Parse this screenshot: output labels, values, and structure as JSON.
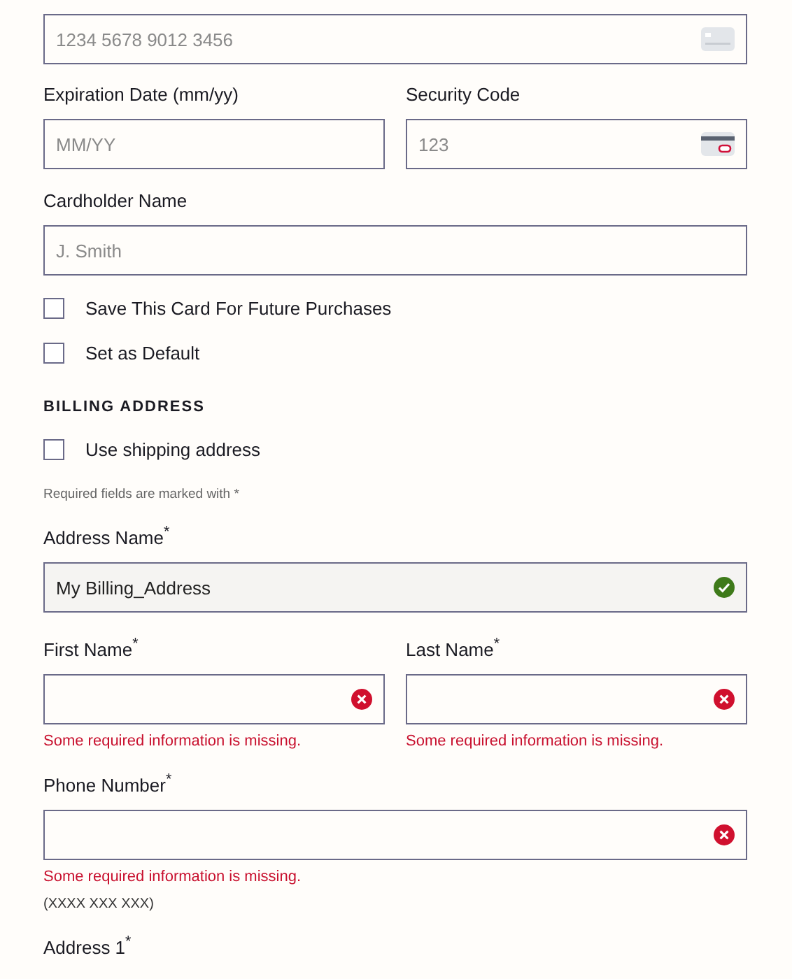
{
  "card_number": {
    "placeholder": "1234 5678 9012 3456"
  },
  "card_row": [
    {
      "label": "Expiration Date (mm/yy)",
      "placeholder": "MM/YY",
      "kind": "plain"
    },
    {
      "label": "Security Code",
      "placeholder": "123",
      "kind": "cvc"
    }
  ],
  "cardholder": {
    "label": "Cardholder Name",
    "placeholder": "J. Smith"
  },
  "card_options": [
    {
      "label": "Save This Card For Future Purchases",
      "checked": false
    },
    {
      "label": "Set as Default",
      "checked": false
    }
  ],
  "billing": {
    "heading": "BILLING ADDRESS",
    "use_shipping": {
      "label": "Use shipping address",
      "checked": false
    },
    "required_note": "Required fields are marked with *",
    "rows": [
      [
        {
          "label": "Address Name$^{*}$",
          "value": "My Billing_Address",
          "valid": true
        }
      ],
      [
        {
          "label": "First Name$^{*}$",
          "valid": false,
          "error": "Some required information is missing."
        },
        {
          "label": "Last Name$^{*}$",
          "valid": false,
          "error": "Some required information is missing."
        }
      ],
      [
        {
          "label": "Phone Number$^{*}$",
          "valid": false,
          "error": "Some required information is missing.",
          "hint": "(XXXX XXX XXX)"
        }
      ],
      [
        {
          "label": "Address 1$^{*}$"
        }
      ]
    ]
  }
}
